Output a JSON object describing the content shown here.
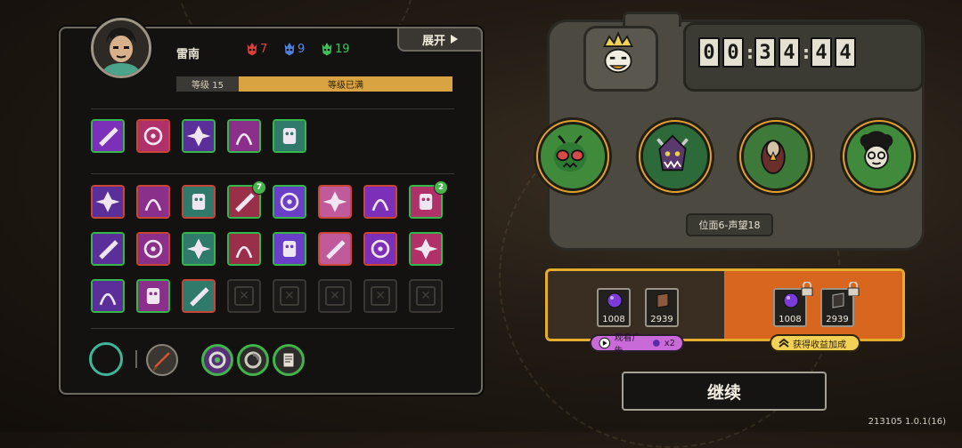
{
  "hero": {
    "name": "雷南",
    "stats": [
      {
        "icon": "red-mask-icon",
        "value": "7",
        "color": "#e0463a"
      },
      {
        "icon": "blue-mask-icon",
        "value": "9",
        "color": "#5a8de6"
      },
      {
        "icon": "green-mask-icon",
        "value": "19",
        "color": "#43c25a"
      }
    ],
    "level_label": "等级 15",
    "level_status": "等级已满",
    "level_progress": 1.0
  },
  "expand_label": "展开",
  "top_skills": [
    {
      "icon": "claw-slash-icon",
      "border": "green"
    },
    {
      "icon": "fist-strike-icon",
      "border": "red"
    },
    {
      "icon": "triskelion-icon",
      "border": "green"
    },
    {
      "icon": "feather-blade-icon",
      "border": "green"
    },
    {
      "icon": "ghost-figure-icon",
      "border": "green"
    }
  ],
  "relics": [
    {
      "icon": "plant-cross-icon",
      "border": "red"
    },
    {
      "icon": "spike-wall-icon",
      "border": "red"
    },
    {
      "icon": "vortex-icon",
      "border": "red"
    },
    {
      "icon": "rib-cage-icon",
      "border": "green",
      "badge": "7"
    },
    {
      "icon": "crossed-blades-icon",
      "border": "green"
    },
    {
      "icon": "eye-sigil-icon",
      "border": "red"
    },
    {
      "icon": "purple-blob-icon",
      "border": "red"
    },
    {
      "icon": "pink-claw-icon",
      "border": "green",
      "badge": "2"
    },
    {
      "icon": "dripping-slime-icon",
      "border": "green"
    },
    {
      "icon": "red-crossbones-icon",
      "border": "red"
    },
    {
      "icon": "target-gem-icon",
      "border": "green"
    },
    {
      "icon": "split-wound-icon",
      "border": "green"
    },
    {
      "icon": "fire-face-icon",
      "border": "green"
    },
    {
      "icon": "lightning-claw-icon",
      "border": "red"
    },
    {
      "icon": "pine-arrows-icon",
      "border": "red"
    },
    {
      "icon": "spiky-star-icon",
      "border": "green"
    },
    {
      "icon": "dark-bird-icon",
      "border": "green"
    },
    {
      "icon": "nerve-web-icon",
      "border": "green"
    },
    {
      "icon": "spiral-coin-icon",
      "border": "red"
    },
    {
      "icon": "empty-slot-icon",
      "border": "empty"
    },
    {
      "icon": "empty-slot-icon",
      "border": "empty"
    },
    {
      "icon": "empty-slot-icon",
      "border": "empty"
    },
    {
      "icon": "empty-slot-icon",
      "border": "empty"
    },
    {
      "icon": "empty-slot-icon",
      "border": "empty"
    }
  ],
  "bottom_slots": [
    "empty-ring-icon",
    "fire-sword-icon",
    "green-spiral-icon",
    "grey-spiral-icon",
    "scroll-icon"
  ],
  "timer": {
    "h": "00",
    "m": "34",
    "s": "44"
  },
  "enemies": [
    "moth-demon-icon",
    "horned-beast-icon",
    "vulture-icon",
    "curly-hair-kid-icon"
  ],
  "plane_label": "位面6-声望18",
  "rewards_free": [
    {
      "icon": "purple-orb-icon",
      "value": "1008"
    },
    {
      "icon": "brown-book-icon",
      "value": "2939"
    }
  ],
  "rewards_locked": [
    {
      "icon": "purple-orb-icon",
      "value": "1008"
    },
    {
      "icon": "dark-book-icon",
      "value": "2939"
    }
  ],
  "watch_ad_label": "观看广告",
  "watch_ad_multiplier": "x2",
  "bonus_label": "获得收益加成",
  "continue_label": "继续",
  "version": "213105 1.0.1(16)"
}
